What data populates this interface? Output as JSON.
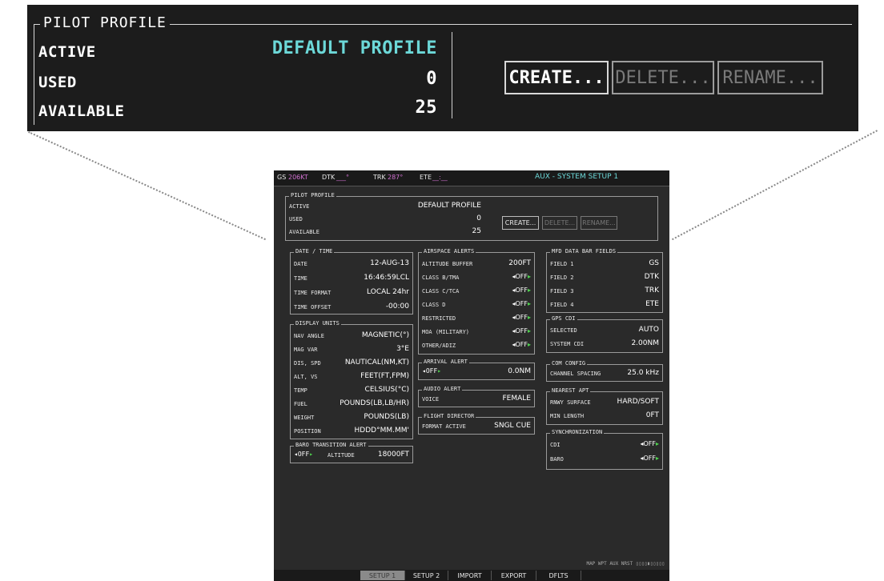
{
  "zoom": {
    "section_title": "PILOT PROFILE",
    "rows": [
      {
        "label": "ACTIVE",
        "value": "DEFAULT PROFILE"
      },
      {
        "label": "USED",
        "value": "0"
      },
      {
        "label": "AVAILABLE",
        "value": "25"
      }
    ],
    "buttons": {
      "create": "CREATE...",
      "delete": "DELETE...",
      "rename": "RENAME..."
    }
  },
  "topbar": {
    "gs_label": "GS",
    "gs_value": "206KT",
    "dtk_label": "DTK",
    "dtk_value": "___°",
    "trk_label": "TRK",
    "trk_value": "287°",
    "ete_label": "ETE",
    "ete_value": "__:__",
    "page_title": "AUX - SYSTEM SETUP 1"
  },
  "pilot_profile": {
    "title": "PILOT PROFILE",
    "active_label": "ACTIVE",
    "active_value": "DEFAULT PROFILE",
    "used_label": "USED",
    "used_value": "0",
    "available_label": "AVAILABLE",
    "available_value": "25",
    "create": "CREATE...",
    "delete": "DELETE...",
    "rename": "RENAME..."
  },
  "date_time": {
    "title": "DATE / TIME",
    "rows": [
      {
        "label": "DATE",
        "value": "12-AUG-13"
      },
      {
        "label": "TIME",
        "value": "16:46:59LCL"
      },
      {
        "label": "TIME FORMAT",
        "value": "LOCAL 24hr"
      },
      {
        "label": "TIME OFFSET",
        "value": "-00:00"
      }
    ]
  },
  "display_units": {
    "title": "DISPLAY UNITS",
    "rows": [
      {
        "label": "NAV ANGLE",
        "value": "MAGNETIC(°)"
      },
      {
        "label": "MAG VAR",
        "value": "3°E"
      },
      {
        "label": "DIS, SPD",
        "value": "NAUTICAL(NM,KT)"
      },
      {
        "label": "ALT, VS",
        "value": "FEET(FT,FPM)"
      },
      {
        "label": "TEMP",
        "value": "CELSIUS(°C)"
      },
      {
        "label": "FUEL",
        "value": "POUNDS(LB,LB/HR)"
      },
      {
        "label": "WEIGHT",
        "value": "POUNDS(LB)"
      },
      {
        "label": "POSITION",
        "value": "HDDD°MM.MM'"
      }
    ]
  },
  "baro_alert": {
    "title": "BARO TRANSITION ALERT",
    "state": "OFF",
    "altitude_label": "ALTITUDE",
    "altitude_value": "18000FT"
  },
  "airspace_alerts": {
    "title": "AIRSPACE ALERTS",
    "rows": [
      {
        "label": "ALTITUDE BUFFER",
        "value": "200FT"
      },
      {
        "label": "CLASS B/TMA",
        "value": "OFF"
      },
      {
        "label": "CLASS C/TCA",
        "value": "OFF"
      },
      {
        "label": "CLASS D",
        "value": "OFF"
      },
      {
        "label": "RESTRICTED",
        "value": "OFF"
      },
      {
        "label": "MOA (MILITARY)",
        "value": "OFF"
      },
      {
        "label": "OTHER/ADIZ",
        "value": "OFF"
      }
    ]
  },
  "arrival_alert": {
    "title": "ARRIVAL ALERT",
    "state": "OFF",
    "value": "0.0NM"
  },
  "audio_alert": {
    "title": "AUDIO ALERT",
    "label": "VOICE",
    "value": "FEMALE"
  },
  "flight_director": {
    "title": "FLIGHT DIRECTOR",
    "label": "FORMAT ACTIVE",
    "value": "SNGL CUE"
  },
  "mfd_fields": {
    "title": "MFD DATA BAR FIELDS",
    "rows": [
      {
        "label": "FIELD 1",
        "value": "GS"
      },
      {
        "label": "FIELD 2",
        "value": "DTK"
      },
      {
        "label": "FIELD 3",
        "value": "TRK"
      },
      {
        "label": "FIELD 4",
        "value": "ETE"
      }
    ]
  },
  "gps_cdi": {
    "title": "GPS CDI",
    "rows": [
      {
        "label": "SELECTED",
        "value": "AUTO"
      },
      {
        "label": "SYSTEM CDI",
        "value": "2.00NM"
      }
    ]
  },
  "com_config": {
    "title": "COM CONFIG",
    "label": "CHANNEL SPACING",
    "value": "25.0 kHz"
  },
  "nearest_apt": {
    "title": "NEAREST APT",
    "rows": [
      {
        "label": "RNWY SURFACE",
        "value": "HARD/SOFT"
      },
      {
        "label": "MIN LENGTH",
        "value": "0FT"
      }
    ]
  },
  "synchronization": {
    "title": "SYNCHRONIZATION",
    "rows": [
      {
        "label": "CDI",
        "value": "OFF"
      },
      {
        "label": "BARO",
        "value": "OFF"
      }
    ]
  },
  "map_bar": "MAP WPT AUX NRST",
  "softkeys": [
    "SETUP 1",
    "SETUP 2",
    "IMPORT",
    "EXPORT",
    "DFLTS"
  ]
}
